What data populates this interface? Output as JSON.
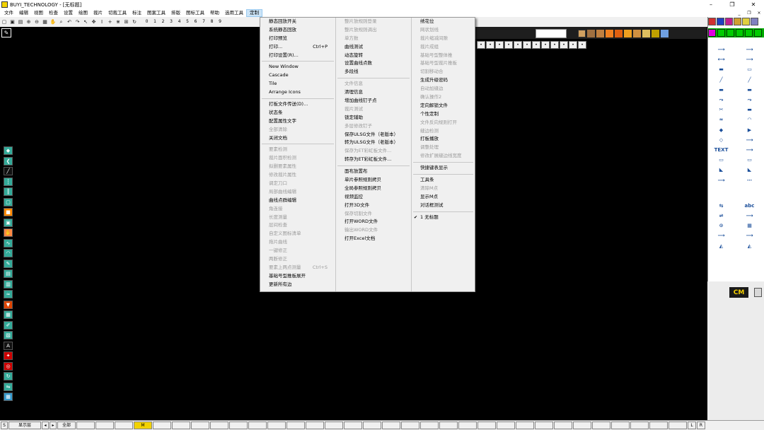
{
  "window": {
    "title": "BUYI_TECHNOLOGY - [无标题]",
    "minimize": "–",
    "maximize": "❐",
    "close": "✕"
  },
  "menubar": {
    "items": [
      "文件",
      "编辑",
      "视图",
      "检查",
      "设置",
      "绘图",
      "裁片",
      "切裁工具",
      "标注",
      "图案工具",
      "排版",
      "图标工具",
      "帮助",
      "选用工具",
      "定制"
    ],
    "active_index": 14,
    "mdi_min": "_",
    "mdi_restore": "❐",
    "mdi_close": "×"
  },
  "toolbar": {
    "numbers": [
      "0",
      "1",
      "2",
      "3",
      "4",
      "5",
      "6",
      "7",
      "8",
      "9"
    ]
  },
  "dot_row_count": 12,
  "dropdown": {
    "col1": [
      {
        "label": "静态回放开关",
        "disabled": false
      },
      {
        "label": "系统静态回放",
        "disabled": false
      },
      {
        "label": "打印预览",
        "disabled": false
      },
      {
        "label": "打印...",
        "shortcut": "Ctrl+P",
        "disabled": false
      },
      {
        "label": "打印设置(R)...",
        "disabled": false
      },
      {
        "sep": true
      },
      {
        "label": "New Window",
        "disabled": false
      },
      {
        "label": "Cascade",
        "disabled": false
      },
      {
        "label": "Tile",
        "disabled": false
      },
      {
        "label": "Arrange Icons",
        "disabled": false
      },
      {
        "sep": true
      },
      {
        "label": "打板文件传送(D)...",
        "disabled": false
      },
      {
        "label": "状态条",
        "disabled": false
      },
      {
        "label": "配置属性文字",
        "disabled": false
      },
      {
        "label": "全部清除",
        "disabled": true
      },
      {
        "label": "关闭文档",
        "disabled": false
      },
      {
        "sep": true
      },
      {
        "label": "要素检测",
        "disabled": true
      },
      {
        "label": "裁片面积检测",
        "disabled": true
      },
      {
        "label": "拟删要素属性",
        "disabled": true
      },
      {
        "label": "修改裁片属性",
        "disabled": true
      },
      {
        "label": "调定刀口",
        "disabled": true
      },
      {
        "label": "局部曲线编辑",
        "disabled": true
      },
      {
        "label": "曲线点群编辑",
        "disabled": false
      },
      {
        "label": "角连接",
        "disabled": true
      },
      {
        "label": "长度测量",
        "disabled": true
      },
      {
        "label": "层间检查",
        "disabled": true
      },
      {
        "label": "自定义图标清单",
        "disabled": true
      },
      {
        "label": "拖片曲线",
        "disabled": true
      },
      {
        "label": "一键修正",
        "disabled": true
      },
      {
        "label": "两断修正",
        "disabled": true
      },
      {
        "label": "要素上两点测量",
        "shortcut": "Ctrl+S",
        "disabled": true
      },
      {
        "label": "基础号型推板展开",
        "disabled": false
      },
      {
        "label": "更新所有边",
        "disabled": false
      }
    ],
    "col2": [
      {
        "label": "整片放规则登录",
        "disabled": true
      },
      {
        "label": "整片放规则调出",
        "disabled": true
      },
      {
        "label": "单方数",
        "disabled": true
      },
      {
        "label": "曲线测试",
        "disabled": false
      },
      {
        "label": "动态旋转",
        "disabled": false
      },
      {
        "label": "设置曲线点数",
        "disabled": false
      },
      {
        "label": "多段线",
        "disabled": false
      },
      {
        "sep": true
      },
      {
        "label": "文件信息",
        "disabled": true
      },
      {
        "label": "清理信息",
        "disabled": false
      },
      {
        "label": "增加曲线钉子点",
        "disabled": false
      },
      {
        "label": "裁片测试",
        "disabled": true
      },
      {
        "label": "锁定辅助",
        "disabled": false
      },
      {
        "label": "多层修改钉子",
        "disabled": true
      },
      {
        "label": "保存ULSG文件（老版本）",
        "disabled": false
      },
      {
        "label": "转为ULSG文件（老版本）",
        "disabled": false
      },
      {
        "label": "保存为ET彩虹板文件...",
        "disabled": true
      },
      {
        "label": "转存为ET彩虹板文件...",
        "disabled": false
      },
      {
        "sep": true
      },
      {
        "label": "面布放置布",
        "disabled": false
      },
      {
        "label": "单片参照规则拷贝",
        "disabled": false
      },
      {
        "label": "全局参照规则拷贝",
        "disabled": false
      },
      {
        "label": "视频监控",
        "disabled": false
      },
      {
        "label": "打开3D文件",
        "disabled": false
      },
      {
        "label": "保存切割文件",
        "disabled": true
      },
      {
        "label": "打开WORD文件",
        "disabled": false
      },
      {
        "label": "输出WORD文件",
        "disabled": true
      },
      {
        "label": "打开Excel文档",
        "disabled": false
      }
    ],
    "col3": [
      {
        "label": "绣花位",
        "disabled": false
      },
      {
        "label": "网状划线",
        "disabled": true
      },
      {
        "label": "裁片缩减间隙",
        "disabled": true
      },
      {
        "label": "裁片成组",
        "disabled": true
      },
      {
        "label": "基础号型整体推",
        "disabled": true
      },
      {
        "label": "基础号型裁片推板",
        "disabled": true
      },
      {
        "label": "切割移动合",
        "disabled": true
      },
      {
        "label": "生成升级密码",
        "disabled": false
      },
      {
        "label": "自动加缝边",
        "disabled": true
      },
      {
        "label": "确认操作2",
        "disabled": true
      },
      {
        "label": "定向解锁文件",
        "disabled": false
      },
      {
        "label": "个性定制",
        "disabled": false
      },
      {
        "label": "文件反向规则打开",
        "disabled": true
      },
      {
        "label": "缝边检测",
        "disabled": true
      },
      {
        "label": "打板播放",
        "disabled": false
      },
      {
        "label": "调整处理",
        "disabled": true
      },
      {
        "label": "修改扩展缝边线宽度",
        "disabled": true
      },
      {
        "sep": true
      },
      {
        "label": "快捷键表显示",
        "disabled": false
      },
      {
        "sep": true
      },
      {
        "label": "工具条",
        "disabled": false
      },
      {
        "label": "清除M点",
        "disabled": true
      },
      {
        "label": "显示M点",
        "disabled": false
      },
      {
        "label": "对话框测试",
        "disabled": false
      },
      {
        "sep": true
      },
      {
        "label": "1 无标题",
        "checked": true,
        "check": "✔",
        "disabled": false
      }
    ]
  },
  "right_panel": {
    "tools": [
      "⟶",
      "⟶",
      "⟷",
      "⟶",
      "▬",
      "▭",
      "╱",
      "╱",
      "▬",
      "▬",
      "⤳",
      "⤳",
      "✂",
      "▬",
      "≈",
      "◠",
      "◆",
      "▶",
      "◇",
      "⟶",
      "TEXT",
      "⟶",
      "▭",
      "▭",
      "◣",
      "◣",
      "⟶",
      "⋯",
      "⇆",
      "abc",
      "⇌",
      "⟶",
      "⊙",
      "▦",
      "⟶",
      "⟶",
      "◭",
      "◭"
    ],
    "cm_label": "CM"
  },
  "statusbar": {
    "left_label": "显示层",
    "all_label": "全部",
    "highlight": "M",
    "right_l": "L",
    "right_r": "R",
    "number": "S"
  }
}
